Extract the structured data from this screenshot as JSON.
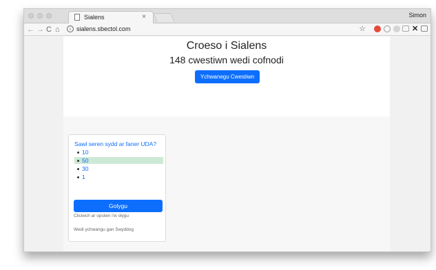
{
  "browser": {
    "tab_title": "Sialens",
    "tab_close": "×",
    "profile_name": "Simon",
    "url": "sialens.sbectol.com",
    "info_glyph": "i",
    "nav": {
      "back": "←",
      "forward": "→",
      "reload": "C",
      "home": "⌂"
    },
    "star": "☆",
    "extensions": [
      {
        "name": "red-stop-extension-icon",
        "color": "#e64a3b"
      },
      {
        "name": "grey-circle-extension-icon",
        "color": "#9a9a9a"
      },
      {
        "name": "grey-drop-extension-icon",
        "color": "#bdbdbd"
      },
      {
        "name": "cast-extension-icon",
        "color": "#8a8a8a"
      },
      {
        "name": "close-x-extension-icon",
        "color": "#222222"
      },
      {
        "name": "square-extension-icon",
        "color": "#9a9a9a"
      },
      {
        "name": "puzzle-extension-icon",
        "color": "#c8c8c8"
      }
    ],
    "menu": "⋮"
  },
  "hero": {
    "title": "Croeso i Sialens",
    "subtitle": "148 cwestiwn wedi cofnodi",
    "add_button": "Ychwanegu Cwestiwn"
  },
  "question_card": {
    "question": "Sawl seren sydd ar faner UDA?",
    "options": [
      {
        "label": "10",
        "selected": false
      },
      {
        "label": "50",
        "selected": true
      },
      {
        "label": "30",
        "selected": false
      },
      {
        "label": "1",
        "selected": false
      }
    ],
    "edit_button": "Golygu",
    "hint": "Cliciwch ar opsiwn i'w olygu",
    "author": "Wedi ychwangu gan Swyddog"
  },
  "colors": {
    "primary": "#0d6efd",
    "selected_option": "#cde9d6"
  }
}
